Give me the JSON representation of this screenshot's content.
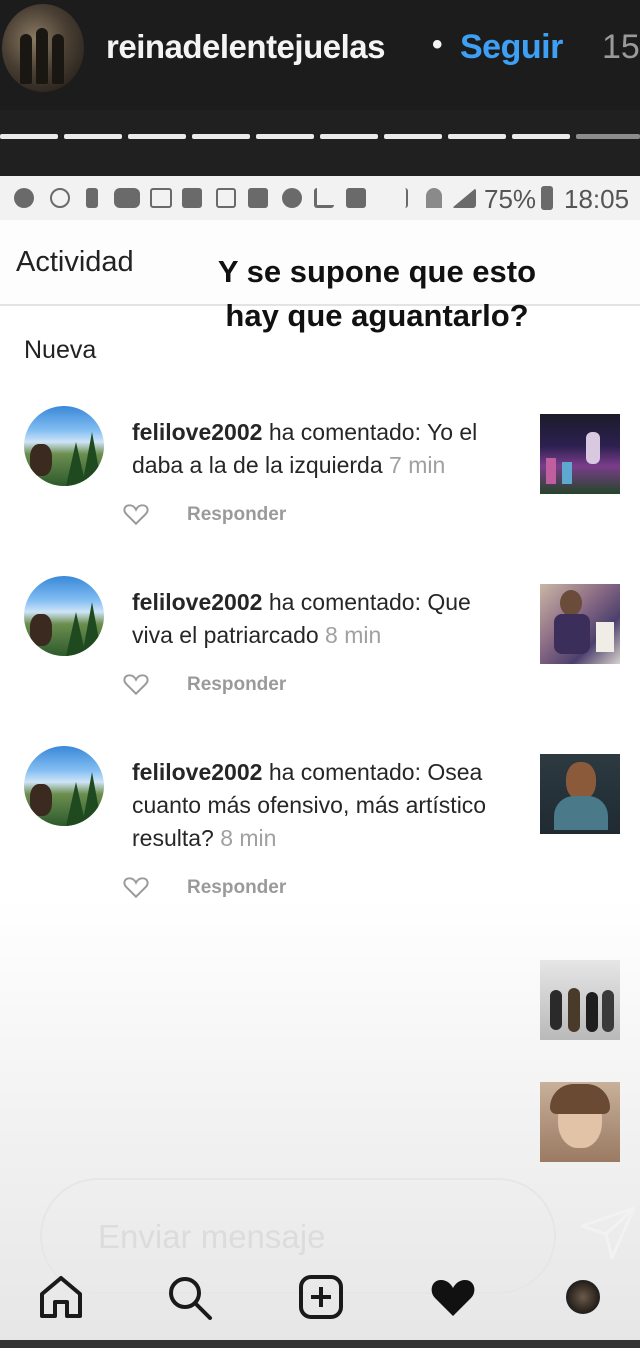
{
  "story": {
    "username": "reinadelentejuelas",
    "separator": "•",
    "follow_label": "Seguir",
    "time": "15",
    "progress_segments": 9
  },
  "status_bar": {
    "battery": "75%",
    "clock": "18:05"
  },
  "activity": {
    "title": "Actividad",
    "overlay_text": "Y se supone que esto hay que aguantarlo?",
    "section_label": "Nueva",
    "comments": [
      {
        "username": "felilove2002",
        "action": "ha comentado:",
        "text": "Yo el daba a la de la izquierda",
        "time": "7 min",
        "reply_label": "Responder",
        "like_icon": "heart-outline-icon"
      },
      {
        "username": "felilove2002",
        "action": "ha comentado:",
        "text": "Que viva el patriarcado",
        "time": "8 min",
        "reply_label": "Responder",
        "like_icon": "heart-outline-icon"
      },
      {
        "username": "felilove2002",
        "action": "ha comentado:",
        "text": "Osea cuanto más ofensivo, más artístico resulta?",
        "time": "8 min",
        "reply_label": "Responder",
        "like_icon": "heart-outline-icon"
      }
    ]
  },
  "message_input": {
    "placeholder": "Enviar mensaje",
    "send_icon": "send-icon"
  },
  "nav": [
    "home-icon",
    "search-icon",
    "add-post-icon",
    "heart-icon",
    "profile-icon"
  ]
}
